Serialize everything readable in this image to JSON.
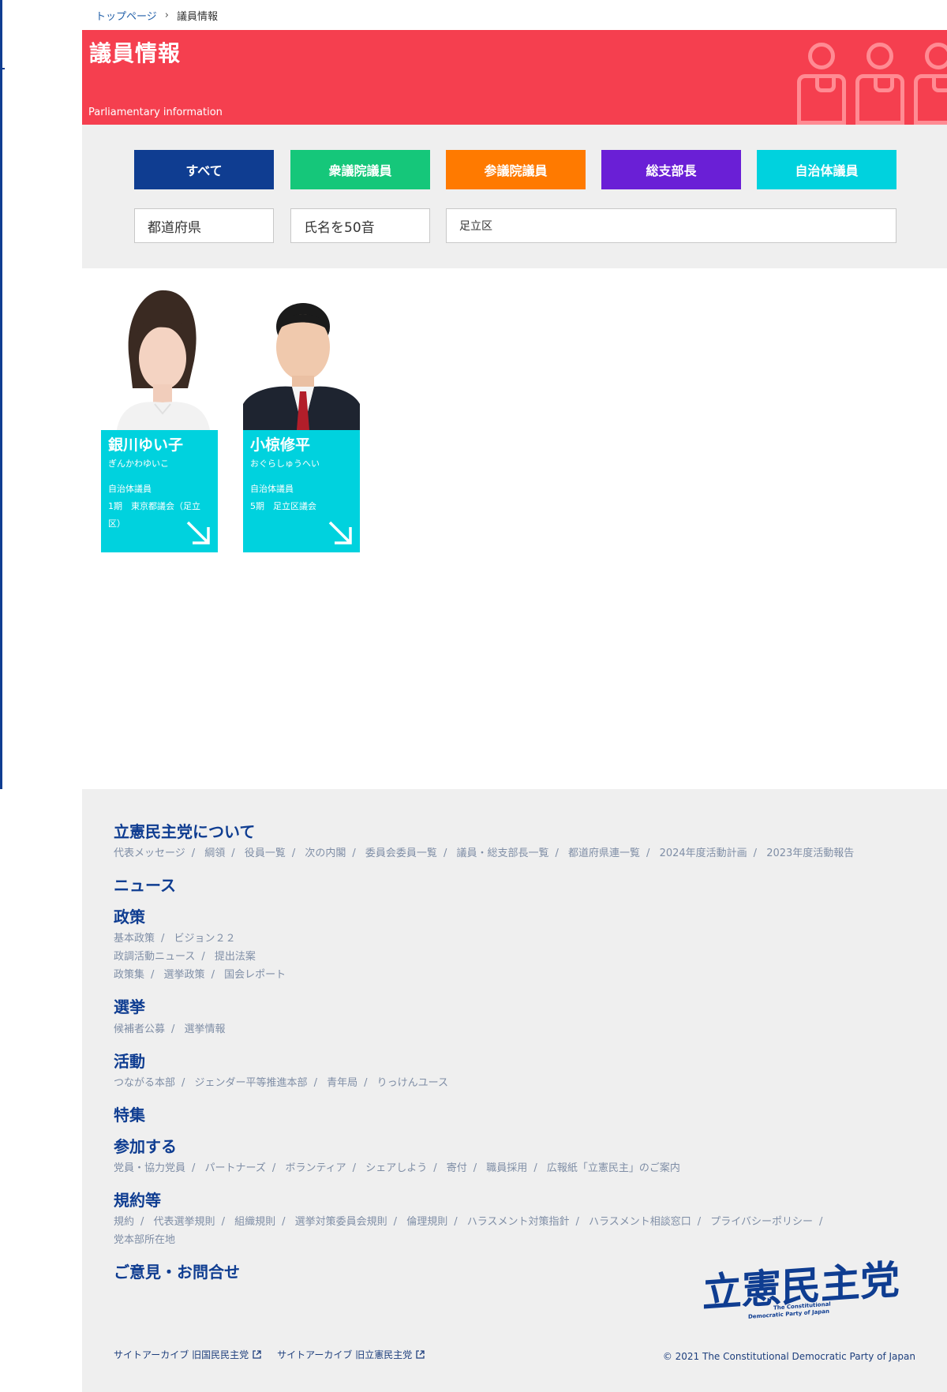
{
  "breadcrumb": {
    "home": "トップページ",
    "sep": "›",
    "current": "議員情報"
  },
  "hero": {
    "title": "議員情報",
    "subtitle": "Parliamentary information",
    "accent": "#f53f4f"
  },
  "categories": [
    {
      "label": "すべて",
      "color": "#0f3d91"
    },
    {
      "label": "衆議院議員",
      "color": "#15c77a"
    },
    {
      "label": "参議院議員",
      "color": "#ff7a00"
    },
    {
      "label": "総支部長",
      "color": "#6a1fd6"
    },
    {
      "label": "自治体議員",
      "color": "#00d2de"
    }
  ],
  "filters": {
    "prefecture": "都道府県",
    "gojuon": "氏名を50音",
    "area": "足立区"
  },
  "members": [
    {
      "name": "銀川ゆい子",
      "kana": "ぎんかわゆいこ",
      "role": "自治体議員",
      "term": "1期　東京都議会（足立区）"
    },
    {
      "name": "小椋修平",
      "kana": "おぐらしゅうへい",
      "role": "自治体議員",
      "term": "5期　足立区議会"
    }
  ],
  "footer": {
    "about": {
      "title": "立憲民主党について",
      "links": [
        "代表メッセージ",
        "綱領",
        "役員一覧",
        "次の内閣",
        "委員会委員一覧",
        "議員・総支部長一覧",
        "都道府県連一覧",
        "2024年度活動計画",
        "2023年度活動報告"
      ]
    },
    "news": {
      "title": "ニュース"
    },
    "policy": {
      "title": "政策",
      "row1": [
        "基本政策",
        "ビジョン２２"
      ],
      "row2": [
        "政調活動ニュース",
        "提出法案"
      ],
      "row3": [
        "政策集",
        "選挙政策",
        "国会レポート"
      ]
    },
    "election": {
      "title": "選挙",
      "links": [
        "候補者公募",
        "選挙情報"
      ]
    },
    "activity": {
      "title": "活動",
      "links": [
        "つながる本部",
        "ジェンダー平等推進本部",
        "青年局",
        "りっけんユース"
      ]
    },
    "feature": {
      "title": "特集"
    },
    "join": {
      "title": "参加する",
      "links": [
        "党員・協力党員",
        "パートナーズ",
        "ボランティア",
        "シェアしよう",
        "寄付",
        "職員採用",
        "広報紙「立憲民主」のご案内"
      ]
    },
    "rules": {
      "title": "規約等",
      "links": [
        "規約",
        "代表選挙規則",
        "組織規則",
        "選挙対策委員会規則",
        "倫理規則",
        "ハラスメント対策指針",
        "ハラスメント相談窓口",
        "プライバシーポリシー"
      ],
      "last": "党本部所在地"
    },
    "contact": {
      "title": "ご意見・お問合せ"
    },
    "archive1": "サイトアーカイブ 旧国民民主党",
    "archive2": "サイトアーカイブ 旧立憲民主党",
    "copyright": "© 2021 The Constitutional Democratic Party of Japan",
    "logo_text": "立憲民主党",
    "logo_en1": "The Constitutional",
    "logo_en2": "Democratic Party of Japan",
    "brand_color": "#0f3d91"
  }
}
